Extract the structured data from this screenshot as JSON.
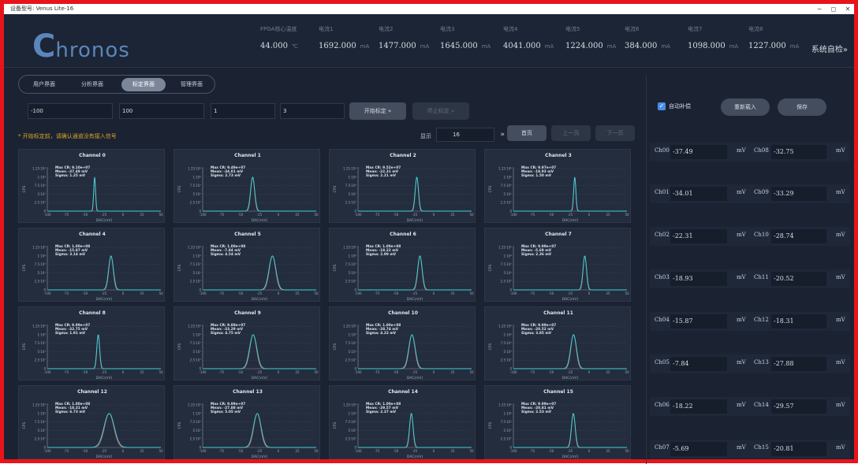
{
  "window": {
    "title": "设备型号: Venus Lite-16",
    "controls": [
      "−",
      "◻",
      "✕"
    ]
  },
  "header": {
    "logo_big": "C",
    "logo_rest": "hronos",
    "metrics": [
      {
        "label": "FPGA核心温度",
        "value": "44.000",
        "unit": "℃"
      },
      {
        "label": "电流1",
        "value": "1692.000",
        "unit": "mA"
      },
      {
        "label": "电流2",
        "value": "1477.000",
        "unit": "mA"
      },
      {
        "label": "电流3",
        "value": "1645.000",
        "unit": "mA"
      },
      {
        "label": "电流4",
        "value": "4041.000",
        "unit": "mA"
      },
      {
        "label": "电流5",
        "value": "1224.000",
        "unit": "mA"
      },
      {
        "label": "电流6",
        "value": "384.000",
        "unit": "mA"
      },
      {
        "label": "电流7",
        "value": "1098.000",
        "unit": "mA"
      },
      {
        "label": "电流8",
        "value": "1227.000",
        "unit": "mA"
      }
    ],
    "self_check": "系统自检»"
  },
  "tabs": [
    "用户界面",
    "分析界面",
    "标定界面",
    "管理界面"
  ],
  "active_tab": 2,
  "params": [
    "-100",
    "100",
    "1",
    "3"
  ],
  "buttons": {
    "start": "开始标定 »",
    "stop": "停止标定 »"
  },
  "warning": "* 开始标定前，请确认通道没有接入信号",
  "pager": {
    "show_label": "显示",
    "per_page": "16",
    "chevron": "»",
    "home": "首页",
    "prev": "上一页",
    "next": "下一页"
  },
  "chart_data": [
    {
      "type": "line",
      "title": "Channel 0",
      "xlabel": "DAC(mV)",
      "ylabel": "CPS",
      "xlim": [
        -100,
        50
      ],
      "stats": [
        "Max CR: 9.10e+07",
        "Mean: -37.49 mV",
        "Sigma: 1.25 mV"
      ],
      "mean": -37.49,
      "sigma": 1.25
    },
    {
      "type": "line",
      "title": "Channel 1",
      "xlabel": "DAC(mV)",
      "ylabel": "CPS",
      "xlim": [
        -100,
        50
      ],
      "stats": [
        "Max CR: 9.49e+07",
        "Mean: -34.01 mV",
        "Sigma: 2.73 mV"
      ],
      "mean": -34.01,
      "sigma": 2.73
    },
    {
      "type": "line",
      "title": "Channel 2",
      "xlabel": "DAC(mV)",
      "ylabel": "CPS",
      "xlim": [
        -100,
        50
      ],
      "stats": [
        "Max CR: 9.52e+07",
        "Mean: -22.31 mV",
        "Sigma: 2.21 mV"
      ],
      "mean": -22.31,
      "sigma": 2.21
    },
    {
      "type": "line",
      "title": "Channel 3",
      "xlabel": "DAC(mV)",
      "ylabel": "CPS",
      "xlim": [
        -100,
        50
      ],
      "stats": [
        "Max CR: 9.97e+07",
        "Mean: -18.93 mV",
        "Sigma: 1.50 mV"
      ],
      "mean": -18.93,
      "sigma": 1.5
    },
    {
      "type": "line",
      "title": "Channel 4",
      "xlabel": "DAC(mV)",
      "ylabel": "CPS",
      "xlim": [
        -100,
        50
      ],
      "stats": [
        "Max CR: 1.00e+08",
        "Mean: -15.87 mV",
        "Sigma: 3.14 mV"
      ],
      "mean": -15.87,
      "sigma": 3.14
    },
    {
      "type": "line",
      "title": "Channel 5",
      "xlabel": "DAC(mV)",
      "ylabel": "CPS",
      "xlim": [
        -100,
        50
      ],
      "stats": [
        "Max CR: 1.00e+08",
        "Mean: -7.84 mV",
        "Sigma: 4.54 mV"
      ],
      "mean": -7.84,
      "sigma": 4.54
    },
    {
      "type": "line",
      "title": "Channel 6",
      "xlabel": "DAC(mV)",
      "ylabel": "CPS",
      "xlim": [
        -100,
        50
      ],
      "stats": [
        "Max CR: 1.00e+08",
        "Mean: -18.22 mV",
        "Sigma: 2.99 mV"
      ],
      "mean": -18.22,
      "sigma": 2.99
    },
    {
      "type": "line",
      "title": "Channel 7",
      "xlabel": "DAC(mV)",
      "ylabel": "CPS",
      "xlim": [
        -100,
        50
      ],
      "stats": [
        "Max CR: 9.99e+07",
        "Mean: -5.69 mV",
        "Sigma: 2.36 mV"
      ],
      "mean": -5.69,
      "sigma": 2.36
    },
    {
      "type": "line",
      "title": "Channel 8",
      "xlabel": "DAC(mV)",
      "ylabel": "CPS",
      "xlim": [
        -100,
        50
      ],
      "stats": [
        "Max CR: 9.99e+07",
        "Mean: -32.75 mV",
        "Sigma: 1.91 mV"
      ],
      "mean": -32.75,
      "sigma": 1.91
    },
    {
      "type": "line",
      "title": "Channel 9",
      "xlabel": "DAC(mV)",
      "ylabel": "CPS",
      "xlim": [
        -100,
        50
      ],
      "stats": [
        "Max CR: 9.88e+07",
        "Mean: -33.29 mV",
        "Sigma: 4.75 mV"
      ],
      "mean": -33.29,
      "sigma": 4.75
    },
    {
      "type": "line",
      "title": "Channel 10",
      "xlabel": "DAC(mV)",
      "ylabel": "CPS",
      "xlim": [
        -100,
        50
      ],
      "stats": [
        "Max CR: 1.00e+08",
        "Mean: -28.74 mV",
        "Sigma: 4.22 mV"
      ],
      "mean": -28.74,
      "sigma": 4.22
    },
    {
      "type": "line",
      "title": "Channel 11",
      "xlabel": "DAC(mV)",
      "ylabel": "CPS",
      "xlim": [
        -100,
        50
      ],
      "stats": [
        "Max CR: 9.99e+07",
        "Mean: -20.52 mV",
        "Sigma: 3.85 mV"
      ],
      "mean": -20.52,
      "sigma": 3.85
    },
    {
      "type": "line",
      "title": "Channel 12",
      "xlabel": "DAC(mV)",
      "ylabel": "CPS",
      "xlim": [
        -100,
        50
      ],
      "stats": [
        "Max CR: 1.00e+08",
        "Mean: -18.31 mV",
        "Sigma: 6.73 mV"
      ],
      "mean": -18.31,
      "sigma": 6.73
    },
    {
      "type": "line",
      "title": "Channel 13",
      "xlabel": "DAC(mV)",
      "ylabel": "CPS",
      "xlim": [
        -100,
        50
      ],
      "stats": [
        "Max CR: 9.99e+07",
        "Mean: -27.88 mV",
        "Sigma: 5.05 mV"
      ],
      "mean": -27.88,
      "sigma": 5.05
    },
    {
      "type": "line",
      "title": "Channel 14",
      "xlabel": "DAC(mV)",
      "ylabel": "CPS",
      "xlim": [
        -100,
        50
      ],
      "stats": [
        "Max CR: 1.00e+08",
        "Mean: -29.57 mV",
        "Sigma: 2.37 mV"
      ],
      "mean": -29.57,
      "sigma": 2.37
    },
    {
      "type": "line",
      "title": "Channel 15",
      "xlabel": "DAC(mV)",
      "ylabel": "CPS",
      "xlim": [
        -100,
        50
      ],
      "stats": [
        "Max CR: 9.99e+07",
        "Mean: -20.81 mV",
        "Sigma: 2.53 mV"
      ],
      "mean": -20.81,
      "sigma": 2.53
    }
  ],
  "chart_axis": {
    "yticks": [
      "1.25·10⁸",
      "1·10⁸",
      "7.5·10⁷",
      "5·10⁷",
      "2.5·10⁷",
      "0"
    ],
    "xticks": [
      "-100",
      "-75",
      "-50",
      "-25",
      "0",
      "25",
      "50"
    ],
    "colors": {
      "curve": "#3fd1d6",
      "fit": "#d9554a",
      "grid": "#3a4558"
    }
  },
  "right": {
    "auto_comp": "自动补偿",
    "reload": "重新载入",
    "save": "保存",
    "unit": "mV",
    "channels_left": [
      {
        "name": "Ch00",
        "value": "-37.49"
      },
      {
        "name": "Ch01",
        "value": "-34.01"
      },
      {
        "name": "Ch02",
        "value": "-22.31"
      },
      {
        "name": "Ch03",
        "value": "-18.93"
      },
      {
        "name": "Ch04",
        "value": "-15.87"
      },
      {
        "name": "Ch05",
        "value": "-7.84"
      },
      {
        "name": "Ch06",
        "value": "-18.22"
      },
      {
        "name": "Ch07",
        "value": "-5.69"
      }
    ],
    "channels_right": [
      {
        "name": "Ch08",
        "value": "-32.75"
      },
      {
        "name": "Ch09",
        "value": "-33.29"
      },
      {
        "name": "Ch10",
        "value": "-28.74"
      },
      {
        "name": "Ch11",
        "value": "-20.52"
      },
      {
        "name": "Ch12",
        "value": "-18.31"
      },
      {
        "name": "Ch13",
        "value": "-27.88"
      },
      {
        "name": "Ch14",
        "value": "-29.57"
      },
      {
        "name": "Ch15",
        "value": "-20.81"
      }
    ]
  }
}
